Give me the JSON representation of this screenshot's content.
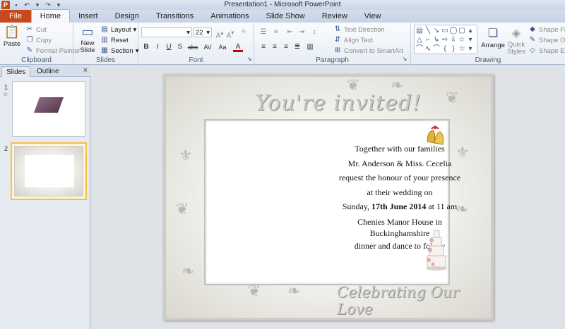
{
  "window": {
    "title": "Presentation1 - Microsoft PowerPoint",
    "app_letter": "P"
  },
  "tabs": [
    {
      "label": "File"
    },
    {
      "label": "Home"
    },
    {
      "label": "Insert"
    },
    {
      "label": "Design"
    },
    {
      "label": "Transitions"
    },
    {
      "label": "Animations"
    },
    {
      "label": "Slide Show"
    },
    {
      "label": "Review"
    },
    {
      "label": "View"
    }
  ],
  "ribbon": {
    "clipboard": {
      "label": "Clipboard",
      "paste": "Paste",
      "cut": "Cut",
      "copy": "Copy",
      "format_painter": "Format Painter"
    },
    "slides": {
      "label": "Slides",
      "new_slide": "New Slide",
      "layout": "Layout",
      "reset": "Reset",
      "section": "Section"
    },
    "font": {
      "label": "Font",
      "font_name": "",
      "font_size": "22",
      "bold": "B",
      "italic": "I",
      "underline": "U",
      "strike": "S",
      "shadow": "abc",
      "spacing": "AV",
      "case": "Aa",
      "color": "A"
    },
    "paragraph": {
      "label": "Paragraph",
      "text_direction": "Text Direction",
      "align_text": "Align Text",
      "convert": "Convert to SmartArt"
    },
    "drawing": {
      "label": "Drawing",
      "arrange": "Arrange",
      "quick_styles": "Quick Styles",
      "shape_fill": "Shape Fill",
      "shape_outline": "Shape Outl",
      "shape_effects": "Shape Effe"
    }
  },
  "left_pane": {
    "tab_slides": "Slides",
    "tab_outline": "Outline",
    "close": "×",
    "thumbs": [
      {
        "num": "1"
      },
      {
        "num": "2"
      }
    ]
  },
  "slide": {
    "headline": "You're invited!",
    "lines": [
      "Together with our families",
      "Mr. Anderson & Miss. Cecelia",
      "request the honour of your presence",
      "at their wedding  on"
    ],
    "date_prefix": "Sunday, ",
    "date_bold": "17th June 2014",
    "date_suffix": " at 11 am",
    "venue_line1": "Chenies Manor House in",
    "venue_line2": "Buckinghamshire",
    "closing": "dinner and dance to follow",
    "footer": "Celebrating Our Love"
  },
  "colors": {
    "file_tab": "#c8491d",
    "selected_thumb": "#f0c14b",
    "ribbon_bg": "#e7edf5"
  }
}
